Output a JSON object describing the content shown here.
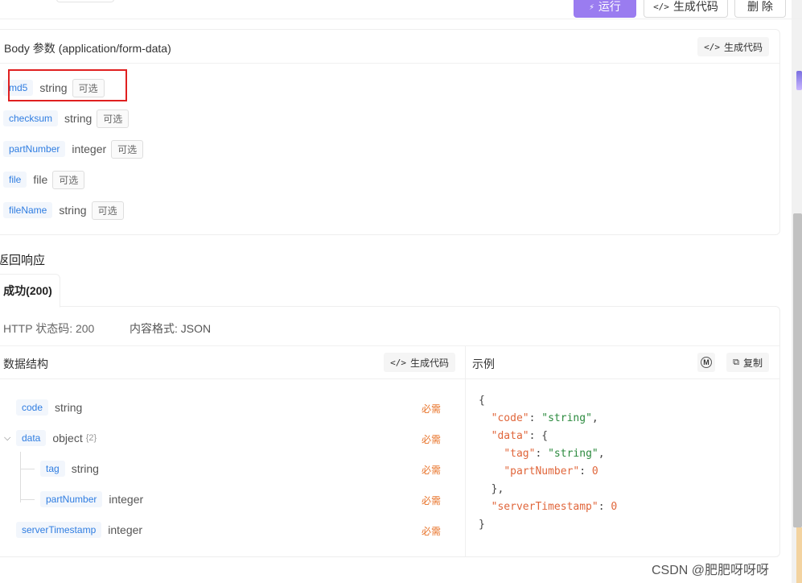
{
  "toolbar": {
    "run_label": "运行",
    "gen_label": "生成代码",
    "delete_label": "删 除",
    "run_icon": "lightning-icon",
    "code_icon": "</>"
  },
  "body_params": {
    "title": "Body 参数 (application/form-data)",
    "gen_label": "生成代码",
    "params": [
      {
        "name": "md5",
        "type": "string",
        "optional": "可选"
      },
      {
        "name": "checksum",
        "type": "string",
        "optional": "可选"
      },
      {
        "name": "partNumber",
        "type": "integer",
        "optional": "可选"
      },
      {
        "name": "file",
        "type": "file",
        "optional": "可选"
      },
      {
        "name": "fileName",
        "type": "string",
        "optional": "可选"
      }
    ]
  },
  "response": {
    "section_title": "返回响应",
    "tab_label": "成功(200)",
    "status_text": "HTTP 状态码: 200",
    "format_text": "内容格式: JSON",
    "schema_title": "数据结构",
    "schema_gen_label": "生成代码",
    "example_title": "示例",
    "copy_label": "复制",
    "mock_icon": "M",
    "fields": [
      {
        "name": "code",
        "type": "string",
        "required": "必需"
      },
      {
        "name": "data",
        "type": "object",
        "count": "{2}",
        "required": "必需"
      },
      {
        "name": "tag",
        "type": "string",
        "required": "必需"
      },
      {
        "name": "partNumber",
        "type": "integer",
        "required": "必需"
      },
      {
        "name": "serverTimestamp",
        "type": "integer",
        "required": "必需"
      }
    ],
    "example": {
      "line1": "{",
      "line2_key": "\"code\"",
      "line2_val": "\"string\"",
      "line3_key": "\"data\"",
      "line4_key": "\"tag\"",
      "line4_val": "\"string\"",
      "line5_key": "\"partNumber\"",
      "line5_val": "0",
      "line6": "},",
      "line7_key": "\"serverTimestamp\"",
      "line7_val": "0",
      "line8": "}"
    }
  },
  "watermark": "CSDN @肥肥呀呀呀"
}
